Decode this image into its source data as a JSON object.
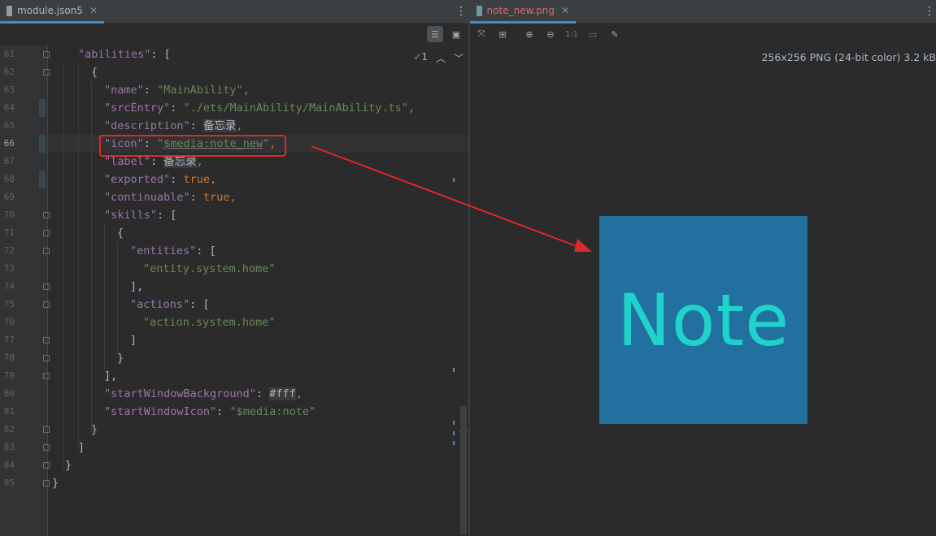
{
  "left_tab": {
    "title": "module.json5"
  },
  "right_tab": {
    "title": "note_new.png"
  },
  "image_info": "256x256 PNG (24-bit color) 3.2 kB",
  "image_text": "Note",
  "inspection": {
    "count": "1"
  },
  "zoom_actual_label": "1:1",
  "colors": {
    "image_bg": "#22709f",
    "image_text": "#1fd3cc",
    "highlight_box": "#e0282a",
    "arrow": "#e0282a"
  },
  "line_numbers": [
    "61",
    "62",
    "63",
    "64",
    "65",
    "66",
    "67",
    "68",
    "69",
    "70",
    "71",
    "72",
    "73",
    "74",
    "75",
    "76",
    "77",
    "78",
    "79",
    "80",
    "81",
    "82",
    "83",
    "84",
    "85"
  ],
  "code": {
    "l61_key": "\"abilities\"",
    "l61_rest": ": [",
    "l62": "{",
    "l63_key": "\"name\"",
    "l63_val": "\"MainAbility\"",
    "l64_key": "\"srcEntry\"",
    "l64_val": "\"./ets/MainAbility/MainAbility.ts\"",
    "l65_key": "\"description\"",
    "l65_val": "备忘录",
    "l66_key": "\"icon\"",
    "l66_q1": "\"",
    "l66_val": "$media:note_new",
    "l66_q2": "\"",
    "l67_key": "\"label\"",
    "l67_val": "备忘录",
    "l68_key": "\"exported\"",
    "l68_val": "true",
    "l69_key": "\"continuable\"",
    "l69_val": "true",
    "l70_key": "\"skills\"",
    "l70_rest": ": [",
    "l71": "{",
    "l72_key": "\"entities\"",
    "l72_rest": ": [",
    "l73_val": "\"entity.system.home\"",
    "l74": "],",
    "l75_key": "\"actions\"",
    "l75_rest": ": [",
    "l76_val": "\"action.system.home\"",
    "l77": "]",
    "l78": "}",
    "l79": "],",
    "l80_key": "\"startWindowBackground\"",
    "l80_val": "#fff",
    "l81_key": "\"startWindowIcon\"",
    "l81_val": "\"$media:note\"",
    "l82": "}",
    "l83": "]",
    "l84": "}",
    "l85": "}"
  }
}
